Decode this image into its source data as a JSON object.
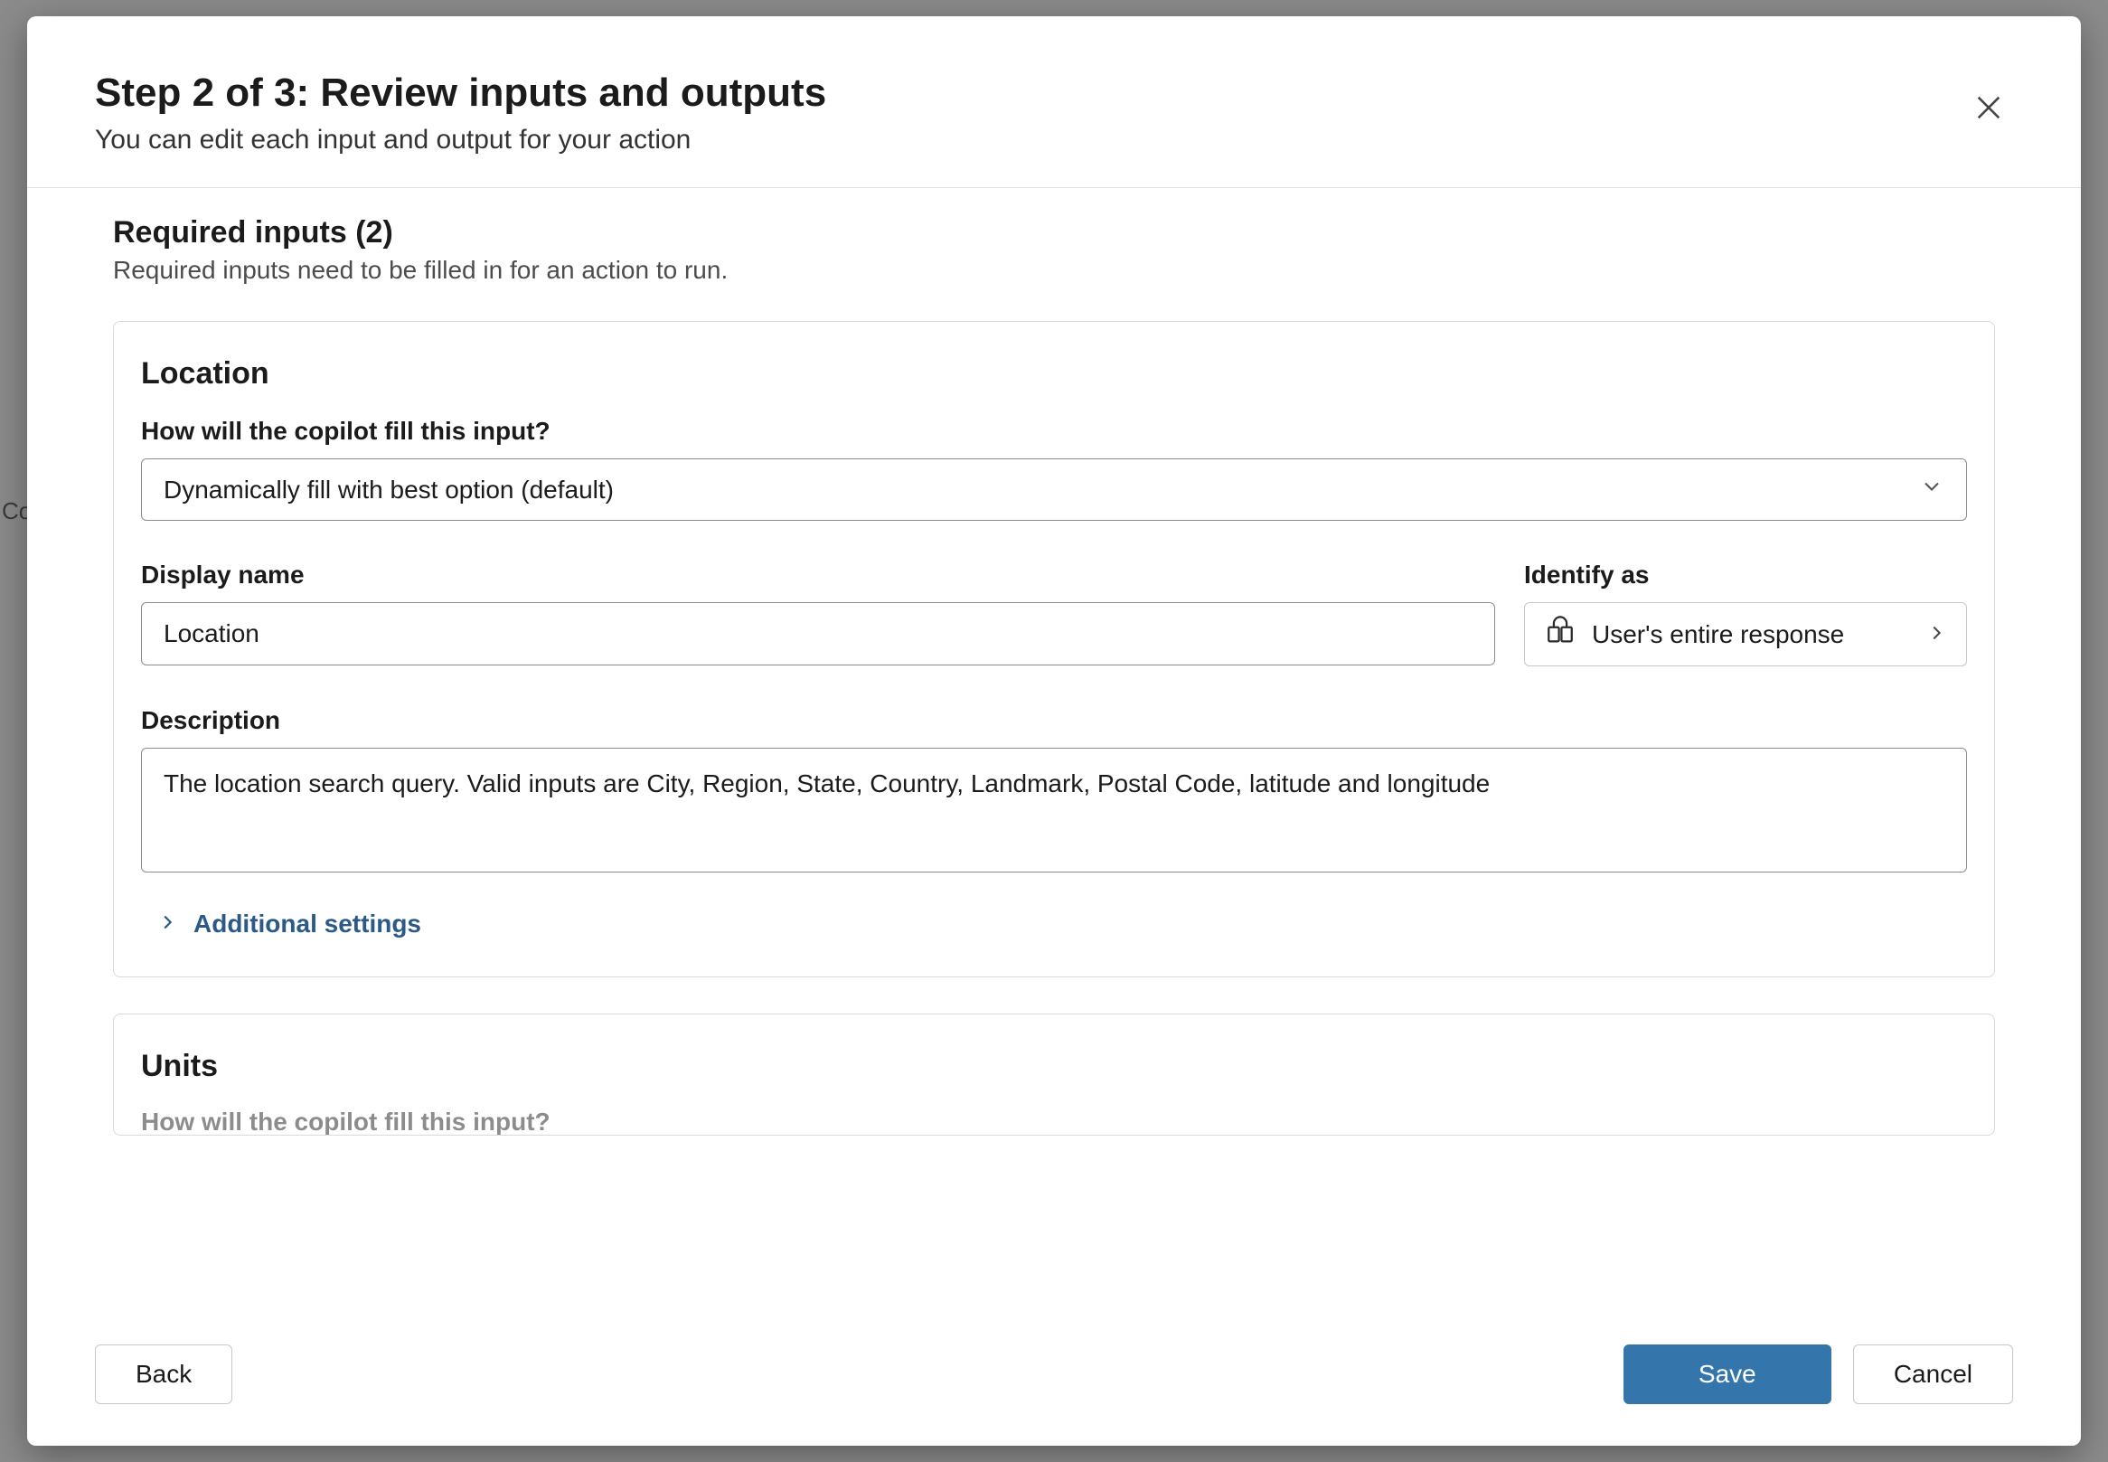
{
  "bg_hint": "Co",
  "header": {
    "title": "Step 2 of 3: Review inputs and outputs",
    "subtitle": "You can edit each input and output for your action"
  },
  "required_section": {
    "title": "Required inputs (2)",
    "subtitle": "Required inputs need to be filled in for an action to run."
  },
  "inputs": [
    {
      "title": "Location",
      "fill_label": "How will the copilot fill this input?",
      "fill_value": "Dynamically fill with best option (default)",
      "display_name_label": "Display name",
      "display_name_value": "Location",
      "identify_label": "Identify as",
      "identify_value": "User's entire response",
      "description_label": "Description",
      "description_value": "The location search query. Valid inputs are City, Region, State, Country, Landmark, Postal Code, latitude and longitude",
      "additional_label": "Additional settings"
    },
    {
      "title": "Units",
      "fill_label_peek": "How will the copilot fill this input?"
    }
  ],
  "footer": {
    "back": "Back",
    "save": "Save",
    "cancel": "Cancel"
  }
}
